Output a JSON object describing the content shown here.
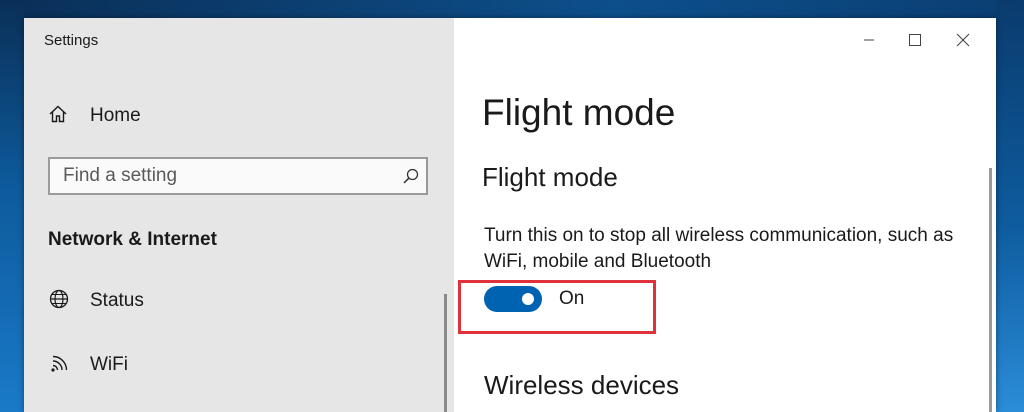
{
  "window": {
    "title": "Settings",
    "controls": [
      "minimize",
      "maximize",
      "close"
    ]
  },
  "sidebar": {
    "home_label": "Home",
    "search": {
      "placeholder": "Find a setting",
      "value": ""
    },
    "section_heading": "Network & Internet",
    "items": [
      {
        "label": "Status",
        "icon": "globe-icon"
      },
      {
        "label": "WiFi",
        "icon": "wifi-icon"
      }
    ]
  },
  "content": {
    "page_title": "Flight mode",
    "subsection_title": "Flight mode",
    "description": "Turn this on to stop all wireless communication, such as WiFi, mobile and Bluetooth",
    "toggle": {
      "state": "On",
      "checked": true
    },
    "next_section_title": "Wireless devices"
  },
  "colors": {
    "accent": "#0063b1",
    "highlight": "#e0323a",
    "sidebar_bg": "#e6e6e6"
  }
}
